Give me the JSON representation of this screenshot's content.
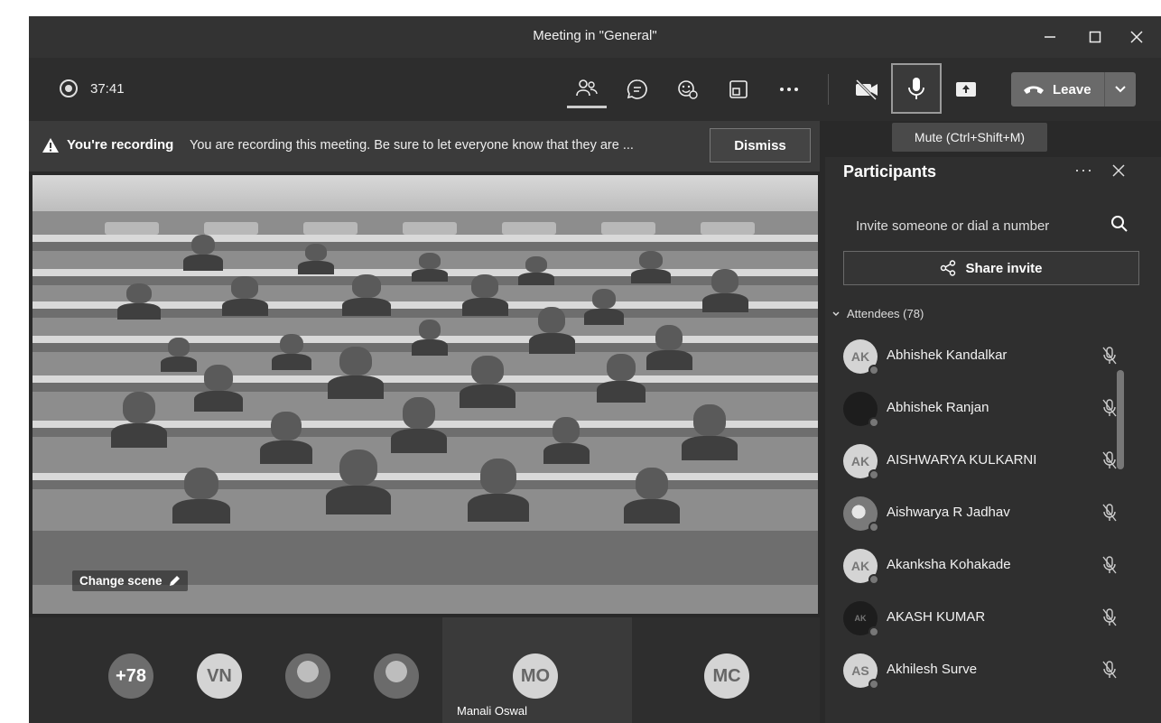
{
  "window": {
    "title": "Meeting in \"General\""
  },
  "toolbar": {
    "timer": "37:41",
    "leave_label": "Leave",
    "mute_tooltip": "Mute (Ctrl+Shift+M)"
  },
  "banner": {
    "bold": "You're recording",
    "message": "You are recording this meeting. Be sure to let everyone know that they are ...",
    "dismiss_label": "Dismiss"
  },
  "stage": {
    "change_scene_label": "Change scene"
  },
  "gallery": {
    "overflow_count": "+78",
    "tiles": [
      {
        "initials": "VN"
      },
      {
        "initials": "MO",
        "name": "Manali Oswal"
      },
      {
        "initials": "MC"
      }
    ]
  },
  "participants": {
    "title": "Participants",
    "invite_placeholder": "Invite someone or dial a number",
    "share_invite_label": "Share invite",
    "attendees_header": "Attendees (78)",
    "attendees": [
      {
        "initials": "AK",
        "name": "Abhishek Kandalkar"
      },
      {
        "initials": "",
        "name": "Abhishek Ranjan"
      },
      {
        "initials": "AK",
        "name": "AISHWARYA KULKARNI"
      },
      {
        "initials": "",
        "name": "Aishwarya R Jadhav"
      },
      {
        "initials": "AK",
        "name": "Akanksha Kohakade"
      },
      {
        "initials": "AK",
        "name": "AKASH KUMAR"
      },
      {
        "initials": "AS",
        "name": "Akhilesh Surve"
      }
    ]
  },
  "icons": {
    "titlebar": [
      "minimize-icon",
      "maximize-icon",
      "close-icon"
    ],
    "toolbar": [
      "people-icon",
      "chat-icon",
      "reactions-icon",
      "breakout-rooms-icon",
      "more-icon",
      "camera-off-icon",
      "microphone-icon",
      "share-tray-icon",
      "phone-icon",
      "chevron-down-icon"
    ],
    "participant_row": [
      "mic-off-icon"
    ]
  }
}
